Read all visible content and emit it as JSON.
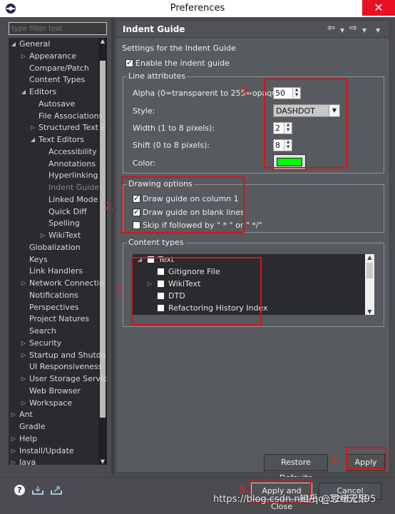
{
  "window": {
    "title": "Preferences",
    "close": "✕"
  },
  "filter": {
    "placeholder": "type filter text"
  },
  "tree": [
    {
      "label": "General",
      "level": 0,
      "expanded": true
    },
    {
      "label": "Appearance",
      "level": 1,
      "expander": true
    },
    {
      "label": "Compare/Patch",
      "level": 1
    },
    {
      "label": "Content Types",
      "level": 1
    },
    {
      "label": "Editors",
      "level": 1,
      "expanded": true
    },
    {
      "label": "Autosave",
      "level": 2
    },
    {
      "label": "File Associations",
      "level": 2
    },
    {
      "label": "Structured Text E",
      "level": 2,
      "expander": true
    },
    {
      "label": "Text Editors",
      "level": 2,
      "expanded": true
    },
    {
      "label": "Accessibility",
      "level": 3
    },
    {
      "label": "Annotations",
      "level": 3
    },
    {
      "label": "Hyperlinking",
      "level": 3
    },
    {
      "label": "Indent Guide",
      "level": 3,
      "selected": true
    },
    {
      "label": "Linked Mode",
      "level": 3
    },
    {
      "label": "Quick Diff",
      "level": 3
    },
    {
      "label": "Spelling",
      "level": 3
    },
    {
      "label": "WikiText",
      "level": 3,
      "expander": true
    },
    {
      "label": "Globalization",
      "level": 1
    },
    {
      "label": "Keys",
      "level": 1
    },
    {
      "label": "Link Handlers",
      "level": 1
    },
    {
      "label": "Network Connectio",
      "level": 1,
      "expander": true
    },
    {
      "label": "Notifications",
      "level": 1
    },
    {
      "label": "Perspectives",
      "level": 1
    },
    {
      "label": "Project Natures",
      "level": 1
    },
    {
      "label": "Search",
      "level": 1
    },
    {
      "label": "Security",
      "level": 1,
      "expander": true
    },
    {
      "label": "Startup and Shutdo",
      "level": 1,
      "expander": true
    },
    {
      "label": "UI Responsiveness",
      "level": 1
    },
    {
      "label": "User Storage Servic",
      "level": 1,
      "expander": true
    },
    {
      "label": "Web Browser",
      "level": 1
    },
    {
      "label": "Workspace",
      "level": 1,
      "expander": true
    },
    {
      "label": "Ant",
      "level": 0,
      "expander": true
    },
    {
      "label": "Gradle",
      "level": 0
    },
    {
      "label": "Help",
      "level": 0,
      "expander": true
    },
    {
      "label": "Install/Update",
      "level": 0,
      "expander": true
    },
    {
      "label": "Java",
      "level": 0,
      "expander": true
    }
  ],
  "page": {
    "title": "Indent Guide",
    "description": "Settings for the Indent Guide",
    "enable_label": "Enable the indent guide",
    "enable_checked": true,
    "nav_back": "⇦",
    "nav_forward": "⇨",
    "nav_dropdown": "▼"
  },
  "line_attributes": {
    "legend": "Line attributes",
    "alpha_label": "Alpha (0=transparent to 255=opaque):",
    "alpha_value": "50",
    "style_label": "Style:",
    "style_value": "DASHDOT",
    "width_label": "Width (1 to 8 pixels):",
    "width_value": "2",
    "shift_label": "Shift (0 to 8 pixels):",
    "shift_value": "8",
    "color_label": "Color:",
    "color_value": "#00ff00"
  },
  "drawing_options": {
    "legend": "Drawing options",
    "options": [
      {
        "label": "Draw guide on column 1",
        "checked": true
      },
      {
        "label": "Draw guide on blank lines",
        "checked": true
      },
      {
        "label": "Skip if followed by \" * \" or \" */\"",
        "checked": false
      }
    ]
  },
  "content_types": {
    "legend": "Content types",
    "items": [
      {
        "label": "Text",
        "level": 0,
        "expander": "◢"
      },
      {
        "label": "Gitignore File",
        "level": 1
      },
      {
        "label": "WikiText",
        "level": 1,
        "expander": "▷"
      },
      {
        "label": "DTD",
        "level": 1
      },
      {
        "label": "Refactoring History Index",
        "level": 1
      }
    ]
  },
  "buttons": {
    "restore_defaults": "Restore Defaults",
    "apply": "Apply",
    "apply_and_close": "Apply and Close",
    "cancel": "Cancel"
  },
  "annotations": [
    "1.",
    "2.",
    "3.",
    "4.",
    "5."
  ],
  "watermark": {
    "url": "https://blog.csdn.net/qq_32662595",
    "brand": "知乎 @思绪无限"
  },
  "colors": {
    "annotation": "#d6141c",
    "panel": "#575a5e",
    "tree_bg": "#2a2b2e"
  }
}
